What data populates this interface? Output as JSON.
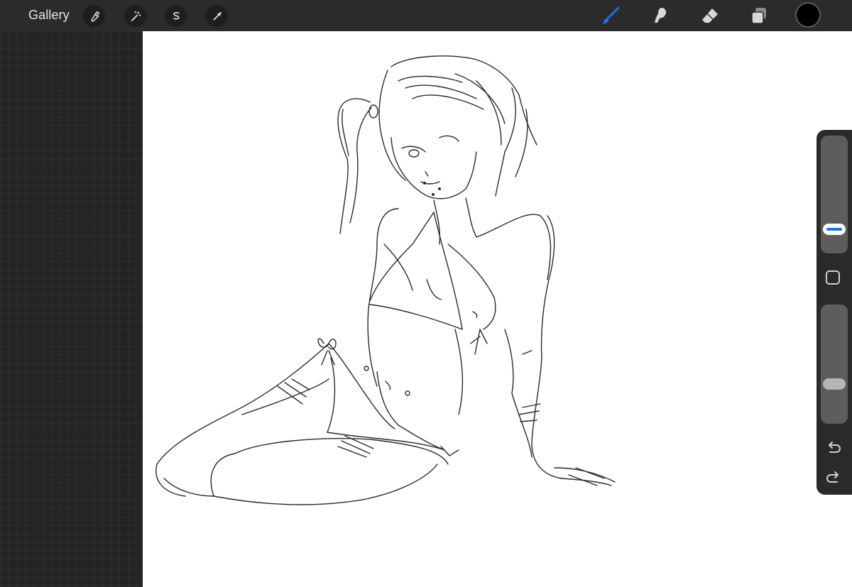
{
  "topbar": {
    "gallery_label": "Gallery",
    "left_tools": [
      "wrench-icon",
      "magic-wand-icon",
      "selection-icon",
      "transform-arrow-icon"
    ],
    "right_tools": [
      "brush-icon",
      "smudge-icon",
      "eraser-icon",
      "layers-icon"
    ],
    "active_tool": "brush",
    "accent_color": "#1a73e8",
    "current_color": "#000000"
  },
  "sidebar": {
    "brush_size_level": 0.25,
    "opacity_level": 0.35,
    "controls": [
      "modify-button",
      "undo-icon",
      "redo-icon"
    ]
  },
  "canvas": {
    "background": "#ffffff",
    "content": "sketch"
  }
}
